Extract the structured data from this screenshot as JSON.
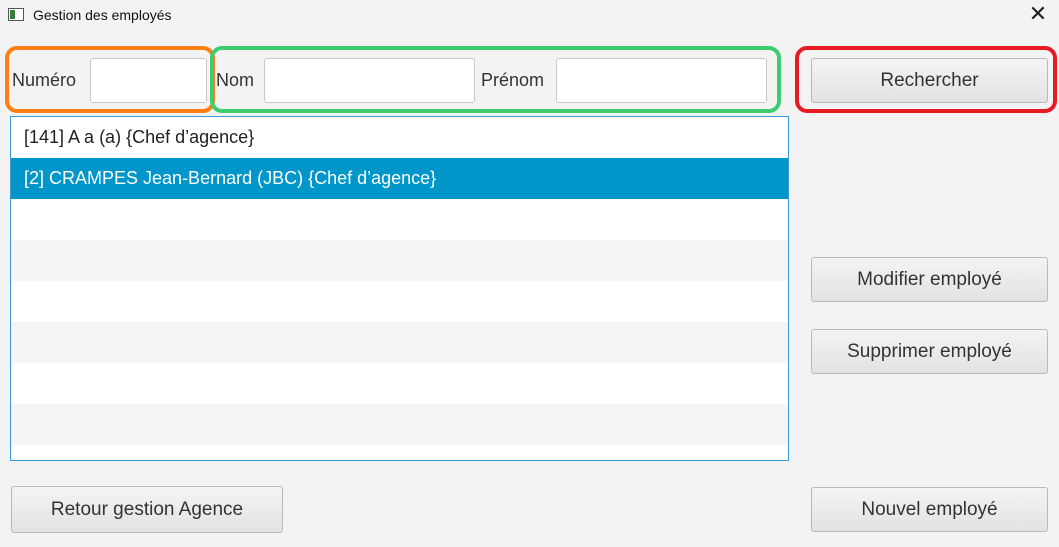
{
  "window": {
    "title": "Gestion des employés",
    "close_glyph": "✕"
  },
  "search": {
    "numero_label": "Numéro",
    "numero_value": "",
    "nom_label": "Nom",
    "nom_value": "",
    "prenom_label": "Prénom",
    "prenom_value": "",
    "search_button": "Rechercher"
  },
  "employees": [
    {
      "text": "[141]  A a (a)  {Chef d’agence}",
      "selected": false
    },
    {
      "text": "[2]  CRAMPES Jean-Bernard (JBC)  {Chef d’agence}",
      "selected": true
    },
    {
      "text": "",
      "selected": false
    },
    {
      "text": "",
      "selected": false
    },
    {
      "text": "",
      "selected": false
    },
    {
      "text": "",
      "selected": false
    },
    {
      "text": "",
      "selected": false
    },
    {
      "text": "",
      "selected": false
    }
  ],
  "actions": {
    "modify": "Modifier employé",
    "delete": "Supprimer employé",
    "new": "Nouvel employé",
    "back": "Retour gestion Agence"
  },
  "highlight_colors": {
    "orange": "#ff7f14",
    "green": "#3dcc6e",
    "red": "#e81b23"
  }
}
